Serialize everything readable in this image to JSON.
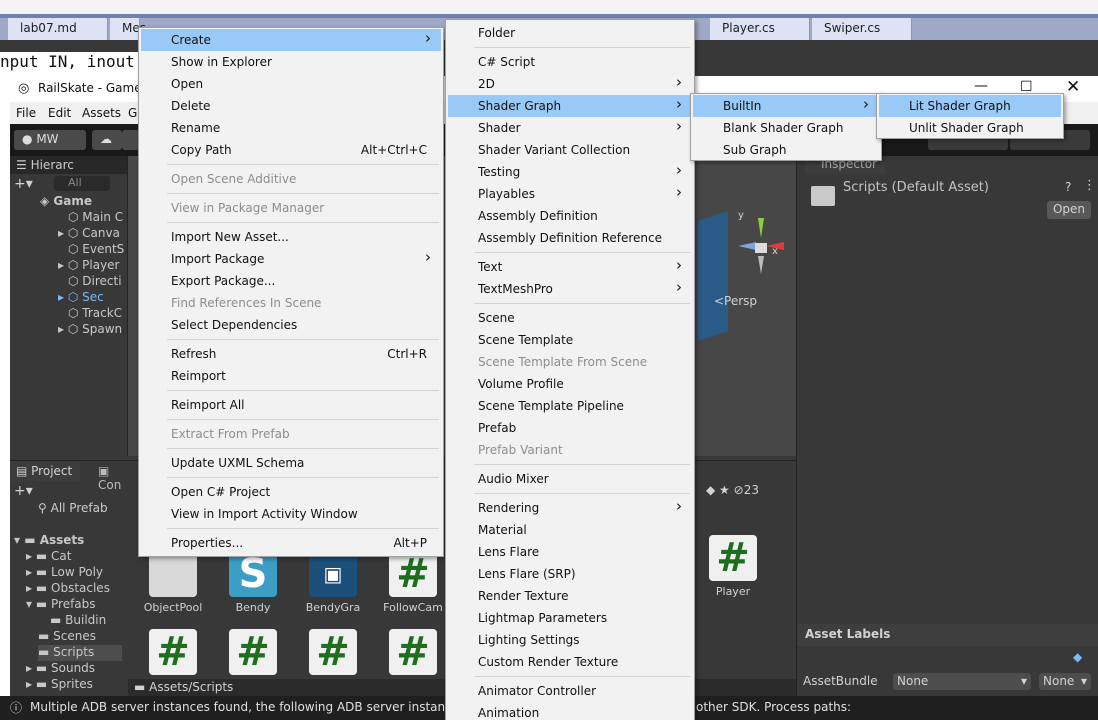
{
  "editor": {
    "tabs": [
      "lab07.md",
      "Mes",
      "",
      "",
      "Player.cs",
      "Swiper.cs"
    ],
    "code_line": "nput IN, inout"
  },
  "window": {
    "title": "RailSkate - Game -",
    "menu": [
      "File",
      "Edit",
      "Assets",
      "G"
    ],
    "account": "MW"
  },
  "hierarchy": {
    "tab": "Hierarc",
    "search": "All",
    "items": [
      "Game",
      "Main C",
      "Canva",
      "EventS",
      "Player",
      "Directi",
      "Sec",
      "TrackC",
      "Spawn"
    ]
  },
  "scene": {
    "persp": "<Persp",
    "axis_y": "y",
    "axis_x": "x"
  },
  "inspector": {
    "tab": "Inspector",
    "title": "Scripts (Default Asset)",
    "open_button": "Open",
    "asset_labels": "Asset Labels",
    "assetbundle_label": "AssetBundle",
    "assetbundle_value": "None",
    "variant_value": "None"
  },
  "project": {
    "tab": "Project",
    "tab2": "Con",
    "search": "All Prefab",
    "hidden_count": "23",
    "path": "Assets/Scripts",
    "tree": [
      "Assets",
      "Cat",
      "Low Poly",
      "Obstacles",
      "Prefabs",
      "Buildin",
      "Scenes",
      "Scripts",
      "Sounds",
      "Sprites"
    ],
    "assets": [
      "ObjectPool",
      "Bendy",
      "BendyGra",
      "FollowCam",
      "Player"
    ]
  },
  "status": {
    "message": "Multiple ADB server instances found, the following ADB server instance ha",
    "message_tail": "other SDK. Process paths:"
  },
  "context_menu": {
    "items": [
      {
        "label": "Create",
        "submenu": true,
        "selected": true
      },
      {
        "label": "Show in Explorer"
      },
      {
        "label": "Open"
      },
      {
        "label": "Delete"
      },
      {
        "label": "Rename"
      },
      {
        "label": "Copy Path",
        "shortcut": "Alt+Ctrl+C"
      },
      {
        "label": "Open Scene Additive",
        "disabled": true
      },
      {
        "label": "View in Package Manager",
        "disabled": true
      },
      {
        "label": "Import New Asset..."
      },
      {
        "label": "Import Package",
        "submenu": true
      },
      {
        "label": "Export Package..."
      },
      {
        "label": "Find References In Scene",
        "disabled": true
      },
      {
        "label": "Select Dependencies"
      },
      {
        "label": "Refresh",
        "shortcut": "Ctrl+R"
      },
      {
        "label": "Reimport"
      },
      {
        "label": "Reimport All"
      },
      {
        "label": "Extract From Prefab",
        "disabled": true
      },
      {
        "label": "Update UXML Schema"
      },
      {
        "label": "Open C# Project"
      },
      {
        "label": "View in Import Activity Window"
      },
      {
        "label": "Properties...",
        "shortcut": "Alt+P"
      }
    ]
  },
  "create_menu": {
    "items": [
      {
        "label": "Folder"
      },
      {
        "label": "C# Script"
      },
      {
        "label": "2D",
        "submenu": true
      },
      {
        "label": "Shader Graph",
        "submenu": true,
        "selected": true
      },
      {
        "label": "Shader",
        "submenu": true
      },
      {
        "label": "Shader Variant Collection"
      },
      {
        "label": "Testing",
        "submenu": true
      },
      {
        "label": "Playables",
        "submenu": true
      },
      {
        "label": "Assembly Definition"
      },
      {
        "label": "Assembly Definition Reference"
      },
      {
        "label": "Text",
        "submenu": true
      },
      {
        "label": "TextMeshPro",
        "submenu": true
      },
      {
        "label": "Scene"
      },
      {
        "label": "Scene Template"
      },
      {
        "label": "Scene Template From Scene",
        "disabled": true
      },
      {
        "label": "Volume Profile"
      },
      {
        "label": "Scene Template Pipeline"
      },
      {
        "label": "Prefab"
      },
      {
        "label": "Prefab Variant",
        "disabled": true
      },
      {
        "label": "Audio Mixer"
      },
      {
        "label": "Rendering",
        "submenu": true
      },
      {
        "label": "Material"
      },
      {
        "label": "Lens Flare"
      },
      {
        "label": "Lens Flare (SRP)"
      },
      {
        "label": "Render Texture"
      },
      {
        "label": "Lightmap Parameters"
      },
      {
        "label": "Lighting Settings"
      },
      {
        "label": "Custom Render Texture"
      },
      {
        "label": "Animator Controller"
      },
      {
        "label": "Animation"
      }
    ]
  },
  "shader_graph_menu": {
    "items": [
      {
        "label": "BuiltIn",
        "submenu": true,
        "selected": true
      },
      {
        "label": "Blank Shader Graph"
      },
      {
        "label": "Sub Graph"
      }
    ]
  },
  "builtin_menu": {
    "items": [
      {
        "label": "Lit Shader Graph",
        "selected": true
      },
      {
        "label": "Unlit Shader Graph"
      }
    ]
  }
}
